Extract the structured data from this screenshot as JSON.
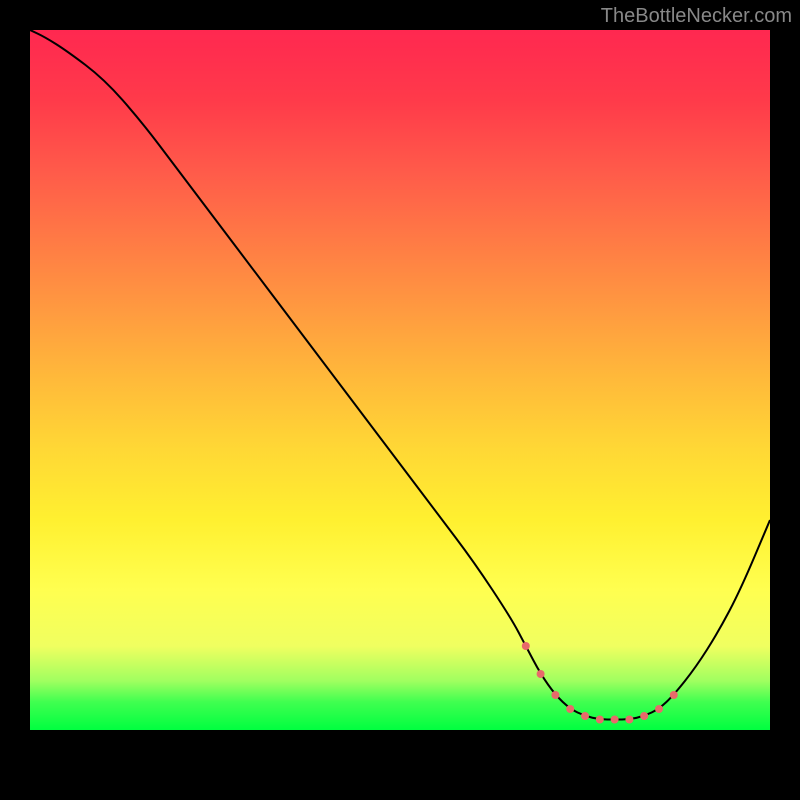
{
  "watermark": "TheBottleNecker.com",
  "chart_data": {
    "type": "line",
    "title": "",
    "xlabel": "",
    "ylabel": "",
    "xlim": [
      0,
      100
    ],
    "ylim": [
      0,
      100
    ],
    "x": [
      0,
      2,
      5,
      10,
      15,
      20,
      25,
      30,
      35,
      40,
      45,
      50,
      55,
      60,
      65,
      67,
      69,
      71,
      73,
      75,
      77,
      79,
      81,
      83,
      85,
      87,
      90,
      93,
      96,
      100
    ],
    "values": [
      100,
      99,
      97,
      93,
      87,
      80,
      73,
      66,
      59,
      52,
      45,
      38,
      31,
      24,
      16,
      12,
      8,
      5,
      3,
      2,
      1.5,
      1.5,
      1.5,
      2,
      3,
      5,
      9,
      14,
      20,
      30
    ],
    "markers": {
      "color": "#e86a6a",
      "style": "dotted",
      "x": [
        67,
        69,
        71,
        73,
        75,
        77,
        79,
        81,
        83,
        85,
        87
      ],
      "values": [
        12,
        8,
        5,
        3,
        2,
        1.5,
        1.5,
        1.5,
        2,
        3,
        5
      ]
    },
    "gradient": {
      "direction": "vertical",
      "stops": [
        {
          "pos": 0,
          "color": "#ff2850"
        },
        {
          "pos": 50,
          "color": "#ffba3a"
        },
        {
          "pos": 85,
          "color": "#ffff50"
        },
        {
          "pos": 100,
          "color": "#00ff40"
        }
      ]
    }
  }
}
